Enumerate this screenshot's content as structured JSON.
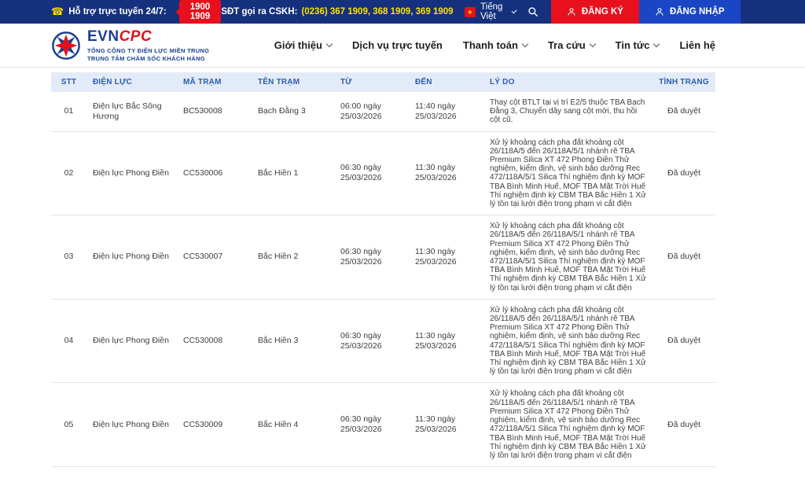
{
  "topbar": {
    "support_label": "Hỗ trợ trực tuyến 24/7:",
    "hotline": "1900 1909",
    "cskh_label": "SĐT gọi ra CSKH:",
    "cskh_numbers": "(0236) 367 1909, 368 1909, 369 1909",
    "language": "Tiếng Việt",
    "register_label": "ĐĂNG KÝ",
    "login_label": "ĐĂNG NHẬP"
  },
  "header": {
    "logo_evn": "EVN",
    "logo_cpc": "CPC",
    "org_line1": "TỔNG CÔNG TY ĐIỆN LỰC MIỀN TRUNG",
    "org_line2": "TRUNG TÂM CHĂM SÓC KHÁCH HÀNG",
    "nav": [
      {
        "label": "Giới thiệu"
      },
      {
        "label": "Dịch vụ trực tuyến"
      },
      {
        "label": "Thanh toán"
      },
      {
        "label": "Tra cứu"
      },
      {
        "label": "Tin tức"
      },
      {
        "label": "Liên hệ"
      }
    ]
  },
  "table": {
    "columns": [
      "STT",
      "ĐIỆN LỰC",
      "MÃ TRẠM",
      "TÊN TRẠM",
      "TỪ",
      "ĐẾN",
      "LÝ DO",
      "TÌNH TRẠNG"
    ],
    "rows": [
      {
        "stt": "01",
        "dien_luc": "Điện lực Bắc Sông Hương",
        "ma_tram": "BC530008",
        "ten_tram": "Bạch Đằng 3",
        "tu": "06:00 ngày 25/03/2026",
        "den": "11:40 ngày 25/03/2026",
        "ly_do": "Thay cột BTLT tại vị trí E2/5 thuộc TBA Bạch Đằng 3, Chuyển dây sang cột mới, thu hồi cột cũ.",
        "tinh_trang": "Đã duyệt"
      },
      {
        "stt": "02",
        "dien_luc": "Điện lực Phong Điền",
        "ma_tram": "CC530006",
        "ten_tram": "Bắc Hiền 1",
        "tu": "06:30 ngày 25/03/2026",
        "den": "11:30 ngày 25/03/2026",
        "ly_do": "Xử lý khoảng cách pha đất khoảng cột 26/118A/5 đến 26/118A/5/1 nhánh rẽ TBA Premium Silica XT 472 Phong Điền Thử nghiệm, kiểm định, vệ sinh bảo dưỡng Rec 472/118A/5/1 Silica Thí nghiệm định kỳ MOF TBA Bình Minh Huế, MOF TBA Mặt Trời Huế Thí nghiệm định kỳ CBM TBA Bắc Hiền 1 Xử lý tồn tại lưới điện trong phạm vi cắt điện",
        "tinh_trang": "Đã duyệt"
      },
      {
        "stt": "03",
        "dien_luc": "Điện lực Phong Điền",
        "ma_tram": "CC530007",
        "ten_tram": "Bắc Hiền 2",
        "tu": "06:30 ngày 25/03/2026",
        "den": "11:30 ngày 25/03/2026",
        "ly_do": "Xử lý khoảng cách pha đất khoảng cột 26/118A/5 đến 26/118A/5/1 nhánh rẽ TBA Premium Silica XT 472 Phong Điền Thử nghiệm, kiểm định, vệ sinh bảo dưỡng Rec 472/118A/5/1 Silica Thí nghiệm định kỳ MOF TBA Bình Minh Huế, MOF TBA Mặt Trời Huế Thí nghiệm định kỳ CBM TBA Bắc Hiền 1 Xử lý tồn tại lưới điện trong phạm vi cắt điện",
        "tinh_trang": "Đã duyệt"
      },
      {
        "stt": "04",
        "dien_luc": "Điện lực Phong Điền",
        "ma_tram": "CC530008",
        "ten_tram": "Bắc Hiền 3",
        "tu": "06:30 ngày 25/03/2026",
        "den": "11:30 ngày 25/03/2026",
        "ly_do": "Xử lý khoảng cách pha đất khoảng cột 26/118A/5 đến 26/118A/5/1 nhánh rẽ TBA Premium Silica XT 472 Phong Điền Thử nghiệm, kiểm định, vệ sinh bảo dưỡng Rec 472/118A/5/1 Silica Thí nghiệm định kỳ MOF TBA Bình Minh Huế, MOF TBA Mặt Trời Huế Thí nghiệm định kỳ CBM TBA Bắc Hiền 1 Xử lý tồn tại lưới điện trong phạm vi cắt điện",
        "tinh_trang": "Đã duyệt"
      },
      {
        "stt": "05",
        "dien_luc": "Điện lực Phong Điền",
        "ma_tram": "CC530009",
        "ten_tram": "Bắc Hiền 4",
        "tu": "06:30 ngày 25/03/2026",
        "den": "11:30 ngày 25/03/2026",
        "ly_do": "Xử lý khoảng cách pha đất khoảng cột 26/118A/5 đến 26/118A/5/1 nhánh rẽ TBA Premium Silica XT 472 Phong Điền Thử nghiệm, kiểm định, vệ sinh bảo dưỡng Rec 472/118A/5/1 Silica Thí nghiệm định kỳ MOF TBA Bình Minh Huế, MOF TBA Mặt Trời Huế Thí nghiệm định kỳ CBM TBA Bắc Hiền 1 Xử lý tồn tại lưới điện trong phạm vi cắt điện",
        "tinh_trang": "Đã duyệt"
      }
    ]
  },
  "colors": {
    "topbar_bg": "#15317e",
    "accent_red": "#e8101c",
    "login_blue": "#1a46c5",
    "hotline_yellow": "#ffe000",
    "table_header_bg": "#e4ebf8",
    "table_header_text": "#2a5db3",
    "logo_blue": "#1b3f8f",
    "logo_red": "#e3101b"
  }
}
